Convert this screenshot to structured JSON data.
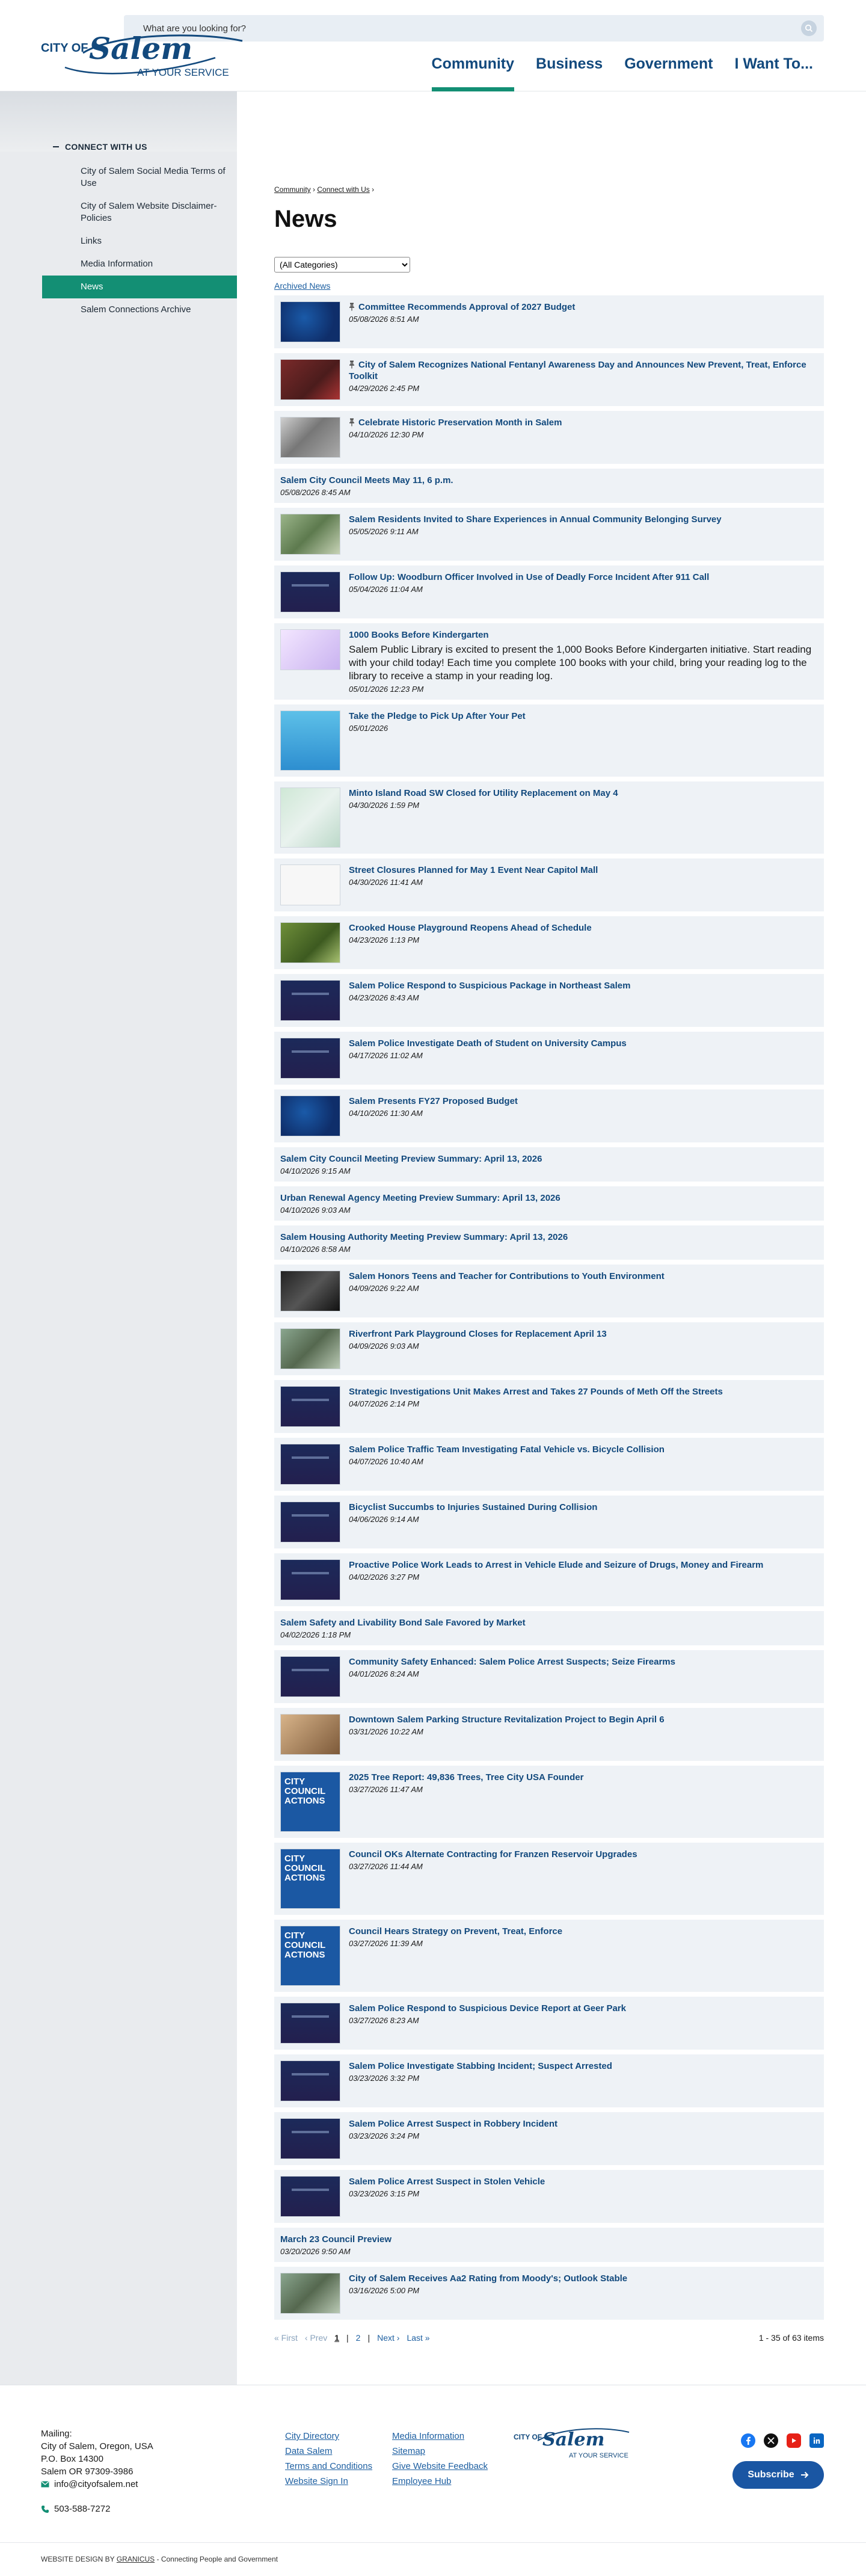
{
  "header": {
    "search_placeholder": "What are you looking for?",
    "logo_top": "CITY OF",
    "logo_script": "Salem",
    "logo_tagline": "AT YOUR SERVICE",
    "nav": [
      {
        "label": "Community"
      },
      {
        "label": "Business"
      },
      {
        "label": "Government"
      },
      {
        "label": "I Want To..."
      }
    ]
  },
  "sidebar": {
    "heading": "CONNECT WITH US",
    "items": [
      {
        "label": "City of Salem Social Media Terms of Use"
      },
      {
        "label": "City of Salem Website Disclaimer-Policies"
      },
      {
        "label": "Links"
      },
      {
        "label": "Media Information"
      },
      {
        "label": "News"
      },
      {
        "label": "Salem Connections Archive"
      }
    ],
    "active_index": 4
  },
  "breadcrumb": {
    "items": [
      "Community",
      "Connect with Us"
    ],
    "sep": "›"
  },
  "page_title": "News",
  "category_select": "(All Categories)",
  "archived_link": "Archived News",
  "news": [
    {
      "title": "Committee Recommends Approval of 2027 Budget",
      "date": "05/08/2026 8:51 AM",
      "thumb": "blue",
      "pinned": true
    },
    {
      "title": "City of Salem Recognizes National Fentanyl Awareness Day and Announces New Prevent, Treat, Enforce Toolkit",
      "date": "04/29/2026 2:45 PM",
      "thumb": "photo-red",
      "pinned": true
    },
    {
      "title": "Celebrate Historic Preservation Month in Salem",
      "date": "04/10/2026 12:30 PM",
      "thumb": "photo-gray",
      "pinned": true
    },
    {
      "title": "Salem City Council Meets May 11, 6 p.m.",
      "date": "05/08/2026 8:45 AM",
      "thumb": ""
    },
    {
      "title": "Salem Residents Invited to Share Experiences in Annual Community Belonging Survey",
      "date": "05/05/2026 9:11 AM",
      "thumb": "photo-green"
    },
    {
      "title": "Follow Up: Woodburn Officer Involved in Use of Deadly Force Incident After 911 Call",
      "date": "05/04/2026 11:04 AM",
      "thumb": "police"
    },
    {
      "title": "1000 Books Before Kindergarten",
      "desc": "Salem Public Library is excited to present the 1,000 Books Before Kindergarten initiative. Start reading with your child today! Each time you complete 100 books with your child, bring your reading log to the library to receive a stamp in your reading log.",
      "date": "05/01/2026 12:23 PM",
      "thumb": "books"
    },
    {
      "title": "Take the Pledge to Pick Up After Your Pet",
      "date": "05/01/2026",
      "thumb": "dog",
      "tall": true
    },
    {
      "title": "Minto Island Road SW Closed for Utility Replacement on May 4",
      "date": "04/30/2026 1:59 PM",
      "thumb": "map",
      "tall": true
    },
    {
      "title": "Street Closures Planned for May 1 Event Near Capitol Mall",
      "date": "04/30/2026 11:41 AM",
      "thumb": "doc"
    },
    {
      "title": "Crooked House Playground Reopens Ahead of Schedule",
      "date": "04/23/2026 1:13 PM",
      "thumb": "park"
    },
    {
      "title": "Salem Police Respond to Suspicious Package in Northeast Salem",
      "date": "04/23/2026 8:43 AM",
      "thumb": "police"
    },
    {
      "title": "Salem Police Investigate Death of Student on University Campus",
      "date": "04/17/2026 11:02 AM",
      "thumb": "police"
    },
    {
      "title": "Salem Presents FY27 Proposed Budget",
      "date": "04/10/2026 11:30 AM",
      "thumb": "blue"
    },
    {
      "title": "Salem City Council Meeting Preview Summary: April 13, 2026",
      "date": "04/10/2026 9:15 AM",
      "thumb": ""
    },
    {
      "title": "Urban Renewal Agency Meeting Preview Summary: April 13, 2026",
      "date": "04/10/2026 9:03 AM",
      "thumb": ""
    },
    {
      "title": "Salem Housing Authority Meeting Preview Summary: April 13, 2026",
      "date": "04/10/2026 8:58 AM",
      "thumb": ""
    },
    {
      "title": "Salem Honors Teens and Teacher for Contributions to Youth Environment",
      "date": "04/09/2026 9:22 AM",
      "thumb": "teens"
    },
    {
      "title": "Riverfront Park Playground Closes for Replacement April 13",
      "date": "04/09/2026 9:03 AM",
      "thumb": "aerial"
    },
    {
      "title": "Strategic Investigations Unit Makes Arrest and Takes 27 Pounds of Meth Off the Streets",
      "date": "04/07/2026 2:14 PM",
      "thumb": "police"
    },
    {
      "title": "Salem Police Traffic Team Investigating Fatal Vehicle vs. Bicycle Collision",
      "date": "04/07/2026 10:40 AM",
      "thumb": "police"
    },
    {
      "title": "Bicyclist Succumbs to Injuries Sustained During Collision",
      "date": "04/06/2026 9:14 AM",
      "thumb": "police"
    },
    {
      "title": "Proactive Police Work Leads to Arrest in Vehicle Elude and Seizure of Drugs, Money and Firearm",
      "date": "04/02/2026 3:27 PM",
      "thumb": "police"
    },
    {
      "title": "Salem Safety and Livability Bond Sale Favored by Market",
      "date": "04/02/2026 1:18 PM",
      "thumb": ""
    },
    {
      "title": "Community Safety Enhanced: Salem Police Arrest Suspects; Seize Firearms",
      "date": "04/01/2026 8:24 AM",
      "thumb": "police"
    },
    {
      "title": "Downtown Salem Parking Structure Revitalization Project to Begin April 6",
      "date": "03/31/2026 10:22 AM",
      "thumb": "orange"
    },
    {
      "title": "2025 Tree Report: 49,836 Trees, Tree City USA Founder",
      "date": "03/27/2026 11:47 AM",
      "thumb": "council",
      "tall": true
    },
    {
      "title": "Council OKs Alternate Contracting for Franzen Reservoir Upgrades",
      "date": "03/27/2026 11:44 AM",
      "thumb": "council",
      "tall": true
    },
    {
      "title": "Council Hears Strategy on Prevent, Treat, Enforce",
      "date": "03/27/2026 11:39 AM",
      "thumb": "council",
      "tall": true
    },
    {
      "title": "Salem Police Respond to Suspicious Device Report at Geer Park",
      "date": "03/27/2026 8:23 AM",
      "thumb": "police"
    },
    {
      "title": "Salem Police Investigate Stabbing Incident; Suspect Arrested",
      "date": "03/23/2026 3:32 PM",
      "thumb": "police"
    },
    {
      "title": "Salem Police Arrest Suspect in Robbery Incident",
      "date": "03/23/2026 3:24 PM",
      "thumb": "police"
    },
    {
      "title": "Salem Police Arrest Suspect in Stolen Vehicle",
      "date": "03/23/2026 3:15 PM",
      "thumb": "police"
    },
    {
      "title": "March 23 Council Preview",
      "date": "03/20/2026 9:50 AM",
      "thumb": ""
    },
    {
      "title": "City of Salem Receives Aa2 Rating from Moody's; Outlook Stable",
      "date": "03/16/2026 5:00 PM",
      "thumb": "aerial"
    }
  ],
  "council_thumb_text": "CITY COUNCIL ACTIONS",
  "pagination": {
    "first": "« First",
    "prev": "‹ Prev",
    "pages": [
      "1",
      "2"
    ],
    "current": "1",
    "next": "Next ›",
    "last": "Last »",
    "count": "1 - 35 of 63 items"
  },
  "footer": {
    "mailing_label": "Mailing:",
    "address_lines": [
      "City of Salem, Oregon, USA",
      "P.O. Box 14300",
      "Salem OR 97309-3986"
    ],
    "email": "info@cityofsalem.net",
    "phone": "503-588-7272",
    "links": [
      {
        "label": "City Directory"
      },
      {
        "label": "Media Information"
      },
      {
        "label": "Data Salem"
      },
      {
        "label": "Sitemap"
      },
      {
        "label": "Terms and Conditions"
      },
      {
        "label": "Give Website Feedback"
      },
      {
        "label": "Website Sign In"
      },
      {
        "label": "Employee Hub"
      }
    ],
    "subscribe": "Subscribe",
    "design_prefix": "WEBSITE DESIGN BY",
    "design_company": "GRANICUS",
    "design_suffix": "- Connecting People and Government"
  },
  "colors": {
    "brand_blue": "#12497d",
    "accent_green": "#138f74",
    "link_blue": "#1d5fa1",
    "card_bg": "#eef2f6"
  }
}
